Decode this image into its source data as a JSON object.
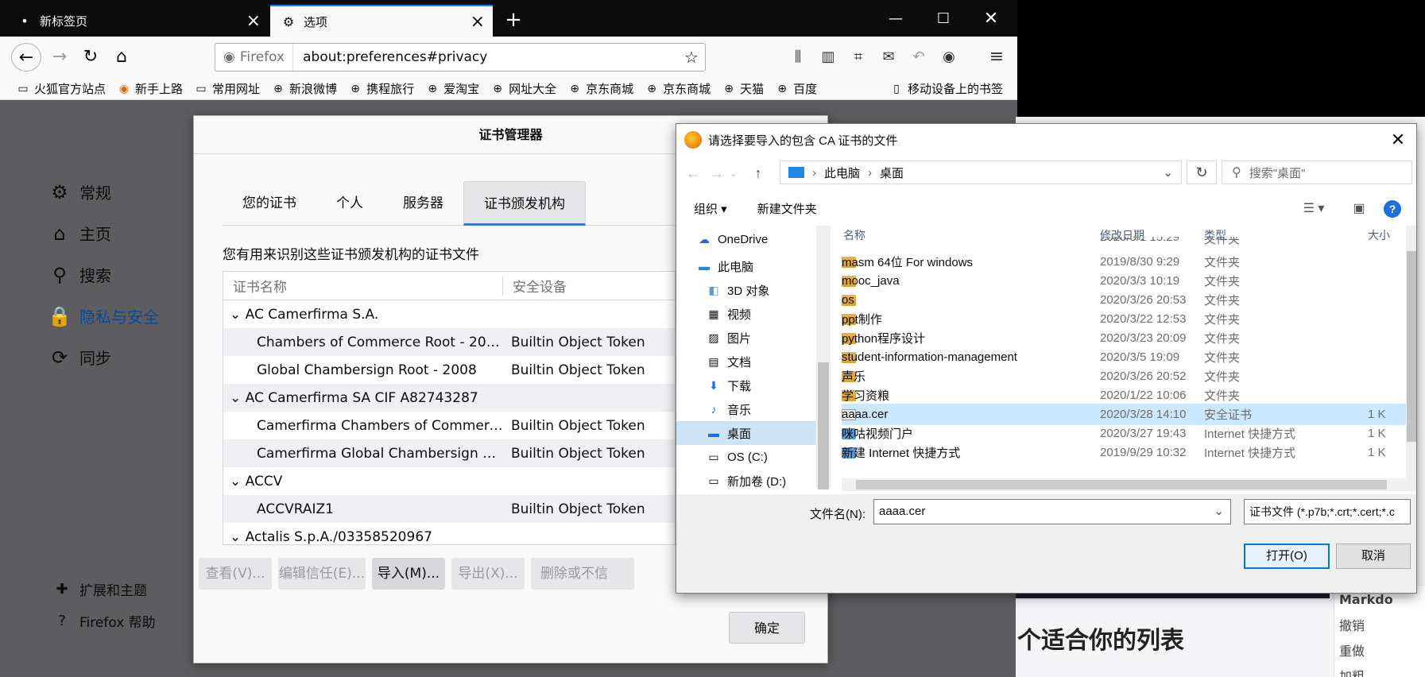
{
  "browser": {
    "tabs": [
      {
        "label": "新标签页"
      },
      {
        "label": "选项"
      }
    ],
    "url": {
      "identity": "Firefox",
      "text": "about:preferences#privacy"
    },
    "bookmarks": [
      "火狐官方站点",
      "新手上路",
      "常用网址",
      "新浪微博",
      "携程旅行",
      "爱淘宝",
      "网址大全",
      "京东商城",
      "京东商城",
      "天猫",
      "百度"
    ],
    "mobile_bookmarks": "移动设备上的书签"
  },
  "preferences": {
    "nav": [
      "常规",
      "主页",
      "搜索",
      "隐私与安全",
      "同步"
    ],
    "bottom": [
      "扩展和主题",
      "Firefox 帮助"
    ]
  },
  "cert_manager": {
    "title": "证书管理器",
    "tabs": [
      "您的证书",
      "个人",
      "服务器",
      "证书颁发机构"
    ],
    "active_tab": "证书颁发机构",
    "description": "您有用来识别这些证书颁发机构的证书文件",
    "columns": [
      "证书名称",
      "安全设备"
    ],
    "rows": [
      {
        "type": "group",
        "name": "AC Camerfirma S.A."
      },
      {
        "type": "child",
        "name": "Chambers of Commerce Root - 2008",
        "device": "Builtin Object Token"
      },
      {
        "type": "child",
        "name": "Global Chambersign Root - 2008",
        "device": "Builtin Object Token"
      },
      {
        "type": "group",
        "name": "AC Camerfirma SA CIF A82743287"
      },
      {
        "type": "child",
        "name": "Camerfirma Chambers of Commerce…",
        "device": "Builtin Object Token"
      },
      {
        "type": "child",
        "name": "Camerfirma Global Chambersign Root",
        "device": "Builtin Object Token"
      },
      {
        "type": "group",
        "name": "ACCV"
      },
      {
        "type": "child",
        "name": "ACCVRAIZ1",
        "device": "Builtin Object Token"
      },
      {
        "type": "group",
        "name": "Actalis S.p.A./03358520967"
      }
    ],
    "buttons": {
      "view": "查看(V)...",
      "edit": "编辑信任(E)...",
      "import": "导入(M)...",
      "export": "导出(X)...",
      "delete": "删除或不信"
    },
    "ok": "确定"
  },
  "file_dialog": {
    "title": "请选择要导入的包含 CA 证书的文件",
    "path": [
      "此电脑",
      "桌面"
    ],
    "search_placeholder": "搜索\"桌面\"",
    "organize": "组织 ▾",
    "new_folder": "新建文件夹",
    "nav": [
      {
        "label": "OneDrive",
        "icon": "cloud-icon"
      },
      {
        "label": "此电脑",
        "icon": "computer-icon"
      },
      {
        "label": "3D 对象",
        "icon": "cube-icon"
      },
      {
        "label": "视频",
        "icon": "video-icon"
      },
      {
        "label": "图片",
        "icon": "picture-icon"
      },
      {
        "label": "文档",
        "icon": "document-icon"
      },
      {
        "label": "下载",
        "icon": "download-icon"
      },
      {
        "label": "音乐",
        "icon": "music-icon"
      },
      {
        "label": "桌面",
        "icon": "desktop-icon"
      },
      {
        "label": "OS (C:)",
        "icon": "drive-icon"
      },
      {
        "label": "新加卷 (D:)",
        "icon": "drive-icon"
      }
    ],
    "nav_selected": "桌面",
    "columns": [
      "名称",
      "修改日期",
      "类型",
      "大小"
    ],
    "files": [
      {
        "name": "index",
        "date": "2020/3/1 15:29",
        "type": "文件夹",
        "size": "",
        "kind": "folder"
      },
      {
        "name": "masm 64位 For windows",
        "date": "2019/8/30 9:29",
        "type": "文件夹",
        "size": "",
        "kind": "folder"
      },
      {
        "name": "mooc_java",
        "date": "2020/3/3 10:19",
        "type": "文件夹",
        "size": "",
        "kind": "folder"
      },
      {
        "name": "os",
        "date": "2020/3/26 20:53",
        "type": "文件夹",
        "size": "",
        "kind": "folder"
      },
      {
        "name": "ppt制作",
        "date": "2020/3/22 12:53",
        "type": "文件夹",
        "size": "",
        "kind": "folder"
      },
      {
        "name": "python程序设计",
        "date": "2020/3/23 20:09",
        "type": "文件夹",
        "size": "",
        "kind": "folder"
      },
      {
        "name": "student-information-management",
        "date": "2020/3/5 19:09",
        "type": "文件夹",
        "size": "",
        "kind": "folder"
      },
      {
        "name": "声乐",
        "date": "2020/3/26 20:52",
        "type": "文件夹",
        "size": "",
        "kind": "folder"
      },
      {
        "name": "学习资粮",
        "date": "2020/1/22 10:06",
        "type": "文件夹",
        "size": "",
        "kind": "folder"
      },
      {
        "name": "aaaa.cer",
        "date": "2020/3/28 14:10",
        "type": "安全证书",
        "size": "1 K",
        "kind": "cert"
      },
      {
        "name": "咪咕视频门户",
        "date": "2020/3/27 19:43",
        "type": "Internet 快捷方式",
        "size": "1 K",
        "kind": "link"
      },
      {
        "name": "新建 Internet 快捷方式",
        "date": "2019/9/29 10:32",
        "type": "Internet 快捷方式",
        "size": "1 K",
        "kind": "link"
      }
    ],
    "selected_file": "aaaa.cer",
    "filename_label": "文件名(N):",
    "filename_value": "aaaa.cer",
    "filter": "证书文件 (*.p7b;*.crt;*.cert;*.c",
    "open": "打开(O)",
    "cancel": "取消"
  },
  "background_page": {
    "heading": "个适合你的列表",
    "side_title": "Markdo",
    "side_items": [
      "撤销",
      "重做",
      "加粗"
    ]
  }
}
